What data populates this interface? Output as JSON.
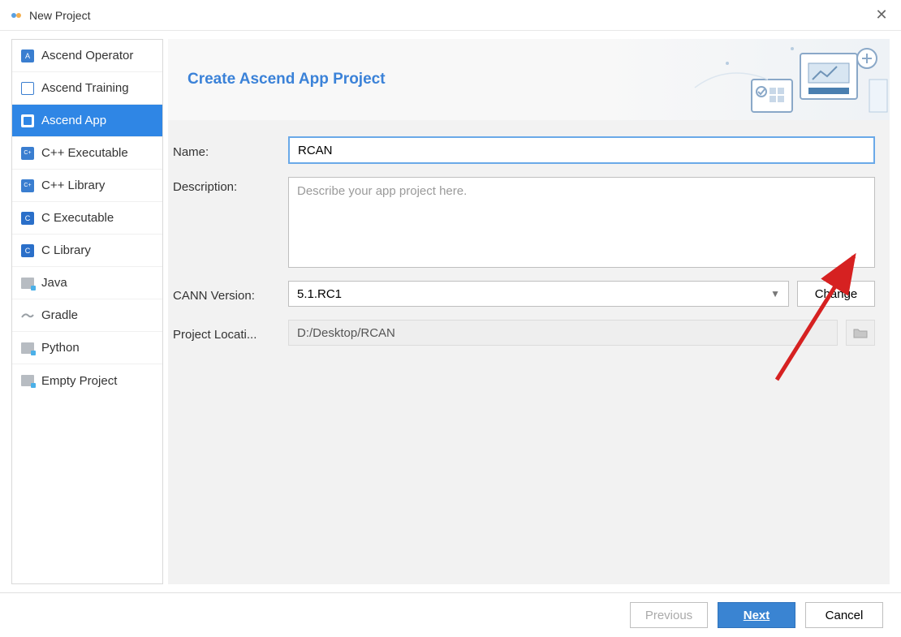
{
  "window": {
    "title": "New Project"
  },
  "sidebar": {
    "items": [
      {
        "label": "Ascend Operator"
      },
      {
        "label": "Ascend Training"
      },
      {
        "label": "Ascend App"
      },
      {
        "label": "C++ Executable"
      },
      {
        "label": "C++ Library"
      },
      {
        "label": "C Executable"
      },
      {
        "label": "C Library"
      },
      {
        "label": "Java"
      },
      {
        "label": "Gradle"
      },
      {
        "label": "Python"
      },
      {
        "label": "Empty Project"
      }
    ]
  },
  "banner": {
    "title": "Create Ascend App Project"
  },
  "form": {
    "name_label": "Name:",
    "name_value": "RCAN",
    "desc_label": "Description:",
    "desc_placeholder": "Describe your app project here.",
    "desc_value": "",
    "cann_label": "CANN Version:",
    "cann_value": "5.1.RC1",
    "change_label": "Change",
    "loc_label": "Project Locati...",
    "loc_value": "D:/Desktop/RCAN"
  },
  "footer": {
    "previous": "Previous",
    "next": "Next",
    "cancel": "Cancel"
  }
}
